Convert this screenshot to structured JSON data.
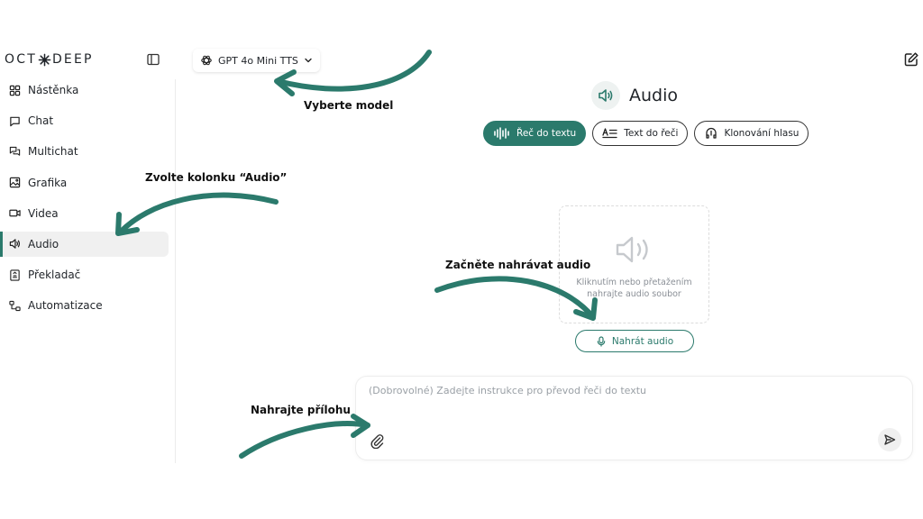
{
  "brand": {
    "left": "OCT",
    "right": "DEEP"
  },
  "header": {
    "model_label": "GPT 4o Mini TTS"
  },
  "sidebar": {
    "items": [
      {
        "label": "Nástěnka",
        "icon": "dashboard-icon"
      },
      {
        "label": "Chat",
        "icon": "chat-icon"
      },
      {
        "label": "Multichat",
        "icon": "multichat-icon"
      },
      {
        "label": "Grafika",
        "icon": "image-icon"
      },
      {
        "label": "Videa",
        "icon": "video-icon"
      },
      {
        "label": "Audio",
        "icon": "speaker-icon",
        "active": true
      },
      {
        "label": "Překladač",
        "icon": "translate-icon"
      },
      {
        "label": "Automatizace",
        "icon": "workflow-icon"
      }
    ]
  },
  "main": {
    "title": "Audio",
    "tabs": [
      {
        "label": "Řeč do textu",
        "active": true
      },
      {
        "label": "Text do řeči",
        "active": false
      },
      {
        "label": "Klonování hlasu",
        "active": false
      }
    ],
    "dropzone_text": "Kliknutím nebo přetažením nahrajte audio soubor",
    "record_label": "Nahrát audio"
  },
  "composer": {
    "placeholder": "(Dobrovolné) Zadejte instrukce pro převod řeči do textu"
  },
  "annotations": {
    "model": "Vyberte model",
    "audio_tab": "Zvolte kolonku “Audio”",
    "record": "Začněte nahrávat audio",
    "attach": "Nahrajte přílohu"
  },
  "colors": {
    "accent": "#2b7a6c",
    "arrow": "#2b7a6c",
    "text": "#1f2328",
    "muted": "#9aa0a6"
  }
}
